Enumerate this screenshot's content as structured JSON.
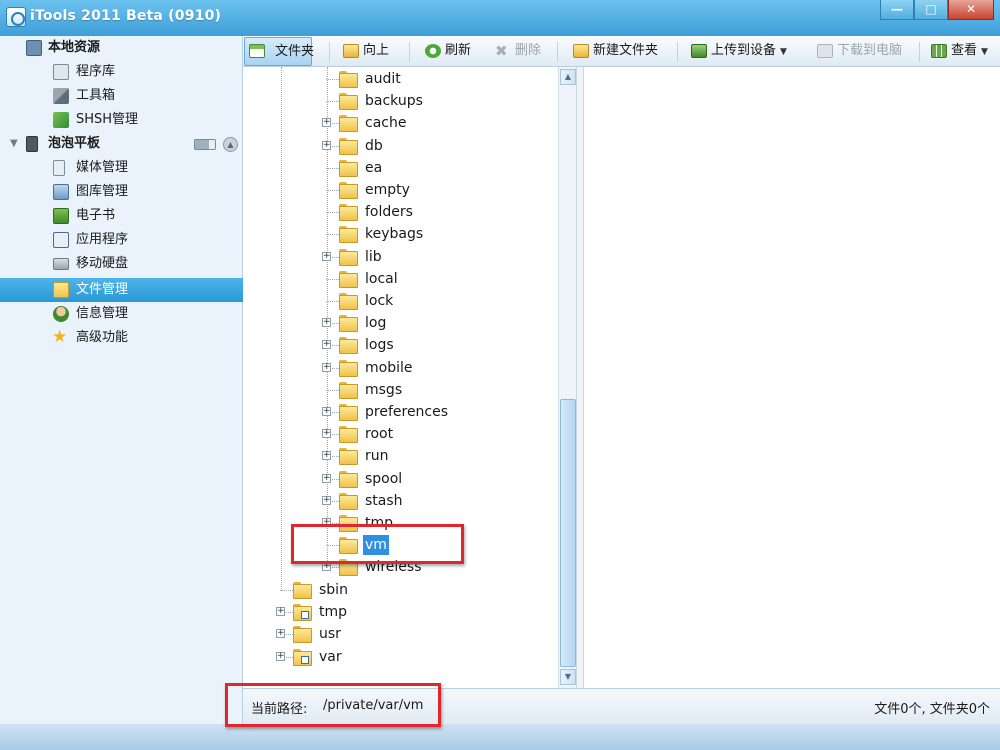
{
  "window": {
    "title": "iTools 2011 Beta (0910)",
    "buttons": {
      "minimize": "—",
      "maximize": "□",
      "close": "✕"
    }
  },
  "sidebar": {
    "local_group": "本地资源",
    "local_items": [
      {
        "label": "程序库",
        "icon": "app-library-icon"
      },
      {
        "label": "工具箱",
        "icon": "toolbox-icon"
      },
      {
        "label": "SHSH管理",
        "icon": "shsh-icon"
      }
    ],
    "device_group": "泡泡平板",
    "device_items": [
      {
        "label": "媒体管理",
        "icon": "media-icon"
      },
      {
        "label": "图库管理",
        "icon": "gallery-icon"
      },
      {
        "label": "电子书",
        "icon": "ebook-icon"
      },
      {
        "label": "应用程序",
        "icon": "apps-icon"
      },
      {
        "label": "移动硬盘",
        "icon": "disk-icon"
      },
      {
        "label": "文件管理",
        "icon": "folder-icon",
        "selected": true
      },
      {
        "label": "信息管理",
        "icon": "contact-icon"
      },
      {
        "label": "高级功能",
        "icon": "star-icon"
      }
    ]
  },
  "toolbar": {
    "folder": "文件夹",
    "up": "向上",
    "refresh": "刷新",
    "delete": "删除",
    "new_folder": "新建文件夹",
    "upload": "上传到设备",
    "download": "下载到电脑",
    "view": "查看"
  },
  "tree": {
    "children": [
      {
        "name": "audit",
        "expandable": false
      },
      {
        "name": "backups",
        "expandable": false
      },
      {
        "name": "cache",
        "expandable": true
      },
      {
        "name": "db",
        "expandable": true
      },
      {
        "name": "ea",
        "expandable": false
      },
      {
        "name": "empty",
        "expandable": false
      },
      {
        "name": "folders",
        "expandable": false
      },
      {
        "name": "keybags",
        "expandable": false
      },
      {
        "name": "lib",
        "expandable": true
      },
      {
        "name": "local",
        "expandable": false
      },
      {
        "name": "lock",
        "expandable": false
      },
      {
        "name": "log",
        "expandable": true
      },
      {
        "name": "logs",
        "expandable": true
      },
      {
        "name": "mobile",
        "expandable": true
      },
      {
        "name": "msgs",
        "expandable": false
      },
      {
        "name": "preferences",
        "expandable": true
      },
      {
        "name": "root",
        "expandable": true
      },
      {
        "name": "run",
        "expandable": true
      },
      {
        "name": "spool",
        "expandable": true
      },
      {
        "name": "stash",
        "expandable": true
      },
      {
        "name": "tmp",
        "expandable": true
      },
      {
        "name": "vm",
        "expandable": false,
        "selected": true
      },
      {
        "name": "wireless",
        "expandable": true
      }
    ],
    "top_level": [
      {
        "name": "sbin",
        "expandable": false,
        "link": false
      },
      {
        "name": "tmp",
        "expandable": true,
        "link": true
      },
      {
        "name": "usr",
        "expandable": true,
        "link": false
      },
      {
        "name": "var",
        "expandable": true,
        "link": true
      }
    ]
  },
  "status": {
    "path_label": "当前路径:",
    "path_value": "/private/var/vm",
    "summary": "文件0个, 文件夹0个"
  },
  "colors": {
    "accent": "#2b98d6",
    "annotation": "#e0262e"
  }
}
